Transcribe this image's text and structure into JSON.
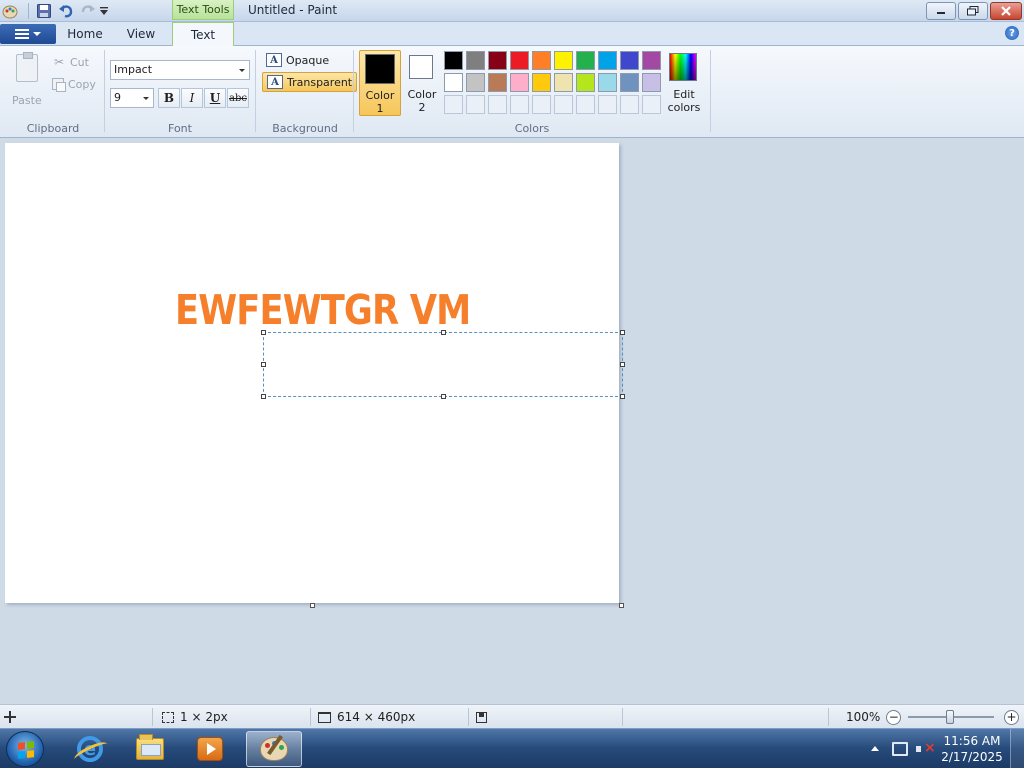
{
  "titlebar": {
    "context_tab": "Text Tools",
    "title": "Untitled - Paint"
  },
  "tabs": {
    "home": "Home",
    "view": "View",
    "text": "Text"
  },
  "ribbon": {
    "clipboard": {
      "paste": "Paste",
      "cut": "Cut",
      "copy": "Copy",
      "group_label": "Clipboard"
    },
    "font": {
      "family": "Impact",
      "size": "9",
      "bold": "B",
      "italic": "I",
      "underline": "U",
      "strike": "abc",
      "group_label": "Font"
    },
    "background": {
      "opaque": "Opaque",
      "transparent": "Transparent",
      "selected": "Transparent",
      "group_label": "Background"
    },
    "colors": {
      "color1_label_top": "Color",
      "color1_label_bottom": "1",
      "color1_value": "#000000",
      "color2_label_top": "Color",
      "color2_label_bottom": "2",
      "color2_value": "#ffffff",
      "edit_top": "Edit",
      "edit_bottom": "colors",
      "group_label": "Colors",
      "palette_row1": [
        "#000000",
        "#7f7f7f",
        "#880015",
        "#ed1c24",
        "#ff7f27",
        "#fff200",
        "#22b14c",
        "#00a2e8",
        "#3f48cc",
        "#a349a4"
      ],
      "palette_row2": [
        "#ffffff",
        "#c3c3c3",
        "#b97a57",
        "#ffaec9",
        "#ffc90e",
        "#efe4b0",
        "#b5e61d",
        "#99d9ea",
        "#7092be",
        "#c8bfe7"
      ]
    }
  },
  "canvas": {
    "text": "EWFEWTGR VM",
    "text_color": "#f57f2b"
  },
  "statusbar": {
    "selection_size": "1 × 2px",
    "image_size": "614 × 460px",
    "zoom": "100%"
  },
  "taskbar": {
    "time": "11:56 AM",
    "date": "2/17/2025"
  }
}
